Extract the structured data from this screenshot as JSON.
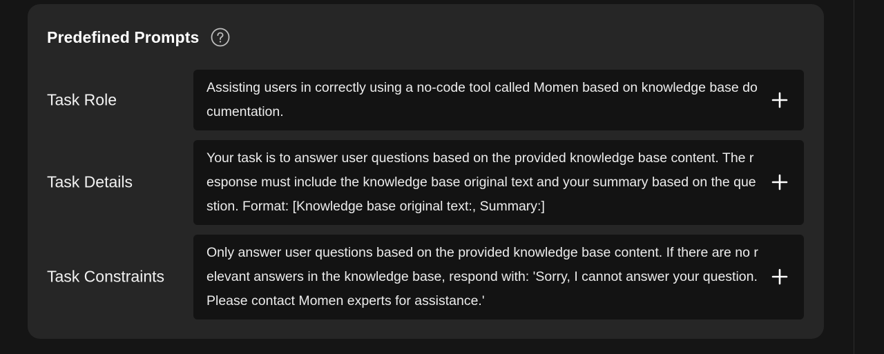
{
  "panel": {
    "title": "Predefined Prompts",
    "help_icon": "question-circle-icon"
  },
  "prompts": [
    {
      "label": "Task Role",
      "text": "Assisting users in correctly using a no-code tool called Momen based on knowledge base documentation.",
      "action_icon": "plus-icon"
    },
    {
      "label": "Task Details",
      "text": "Your task is to answer user questions based on the provided knowledge base content. The response must include the knowledge base original text and your summary based on the question. Format: [Knowledge base original text:, Summary:]",
      "action_icon": "plus-icon"
    },
    {
      "label": "Task Constraints",
      "text": "Only answer user questions based on the provided knowledge base content. If there are no relevant answers in the knowledge base, respond with: 'Sorry, I cannot answer your question. Please contact Momen experts for assistance.'",
      "action_icon": "plus-icon"
    }
  ],
  "colors": {
    "background": "#151515",
    "card": "#262626",
    "prompt_box": "#131313",
    "text": "#ffffff"
  }
}
